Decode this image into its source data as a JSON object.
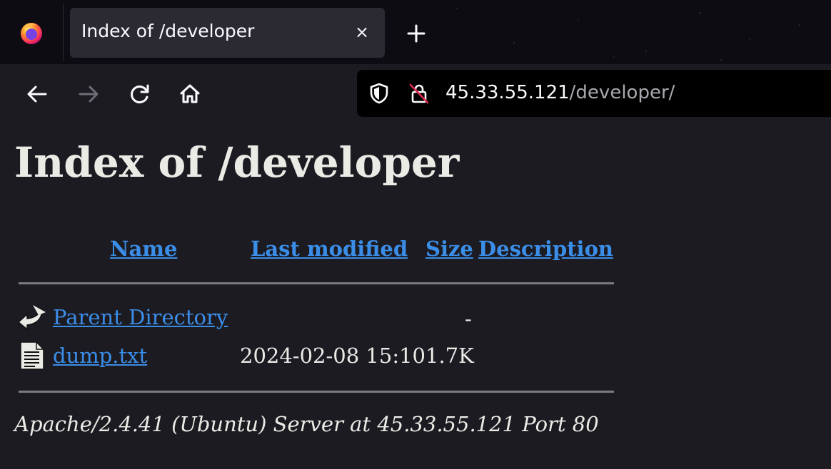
{
  "browser": {
    "tab_title": "Index of /developer",
    "tab_close": "×",
    "url_host": "45.33.55.121",
    "url_path": "/developer/",
    "icons": {
      "logo": "firefox-logo",
      "new_tab": "plus-icon",
      "back": "arrow-left-icon",
      "forward": "arrow-right-icon",
      "reload": "reload-icon",
      "home": "home-icon",
      "shield": "shield-icon",
      "insecure": "insecure-lock-icon"
    },
    "colors": {
      "chrome_bg": "#0c0c12",
      "tab_bg": "#2b2a33",
      "urlbar_bg": "#000000"
    }
  },
  "page": {
    "heading": "Index of /developer",
    "columns": {
      "name": "Name",
      "last_modified": "Last modified",
      "size": "Size",
      "description": "Description"
    },
    "rows": [
      {
        "icon": "back-arrow-icon",
        "name": "Parent Directory",
        "last_modified": "",
        "size": "-",
        "description": ""
      },
      {
        "icon": "text-file-icon",
        "name": "dump.txt",
        "last_modified": "2024-02-08 15:10",
        "size": "1.7K",
        "description": ""
      }
    ],
    "footer": "Apache/2.4.41 (Ubuntu) Server at 45.33.55.121 Port 80",
    "colors": {
      "background": "#1c1b22",
      "text": "#ebebe6",
      "link": "#3b8ee8"
    }
  }
}
